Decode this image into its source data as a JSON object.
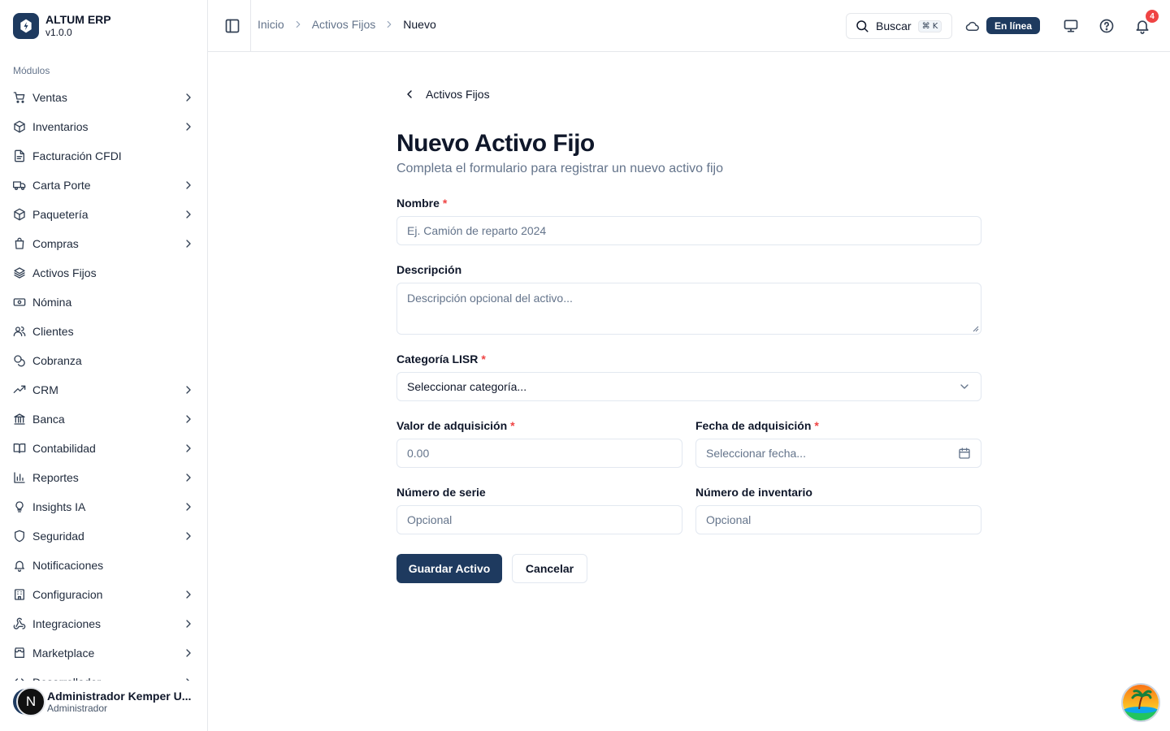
{
  "app": {
    "name": "ALTUM ERP",
    "version": "v1.0.0"
  },
  "sidebar": {
    "section_label": "Módulos",
    "items": [
      {
        "label": "Ventas",
        "icon": "cart-icon",
        "expandable": true
      },
      {
        "label": "Inventarios",
        "icon": "package-icon",
        "expandable": true
      },
      {
        "label": "Facturación CFDI",
        "icon": "file-text-icon",
        "expandable": false
      },
      {
        "label": "Carta Porte",
        "icon": "truck-icon",
        "expandable": true
      },
      {
        "label": "Paquetería",
        "icon": "package-icon",
        "expandable": true
      },
      {
        "label": "Compras",
        "icon": "shopping-bag-icon",
        "expandable": true
      },
      {
        "label": "Activos Fijos",
        "icon": "layers-icon",
        "expandable": false
      },
      {
        "label": "Nómina",
        "icon": "banknote-icon",
        "expandable": false
      },
      {
        "label": "Clientes",
        "icon": "users-icon",
        "expandable": false
      },
      {
        "label": "Cobranza",
        "icon": "coins-icon",
        "expandable": false
      },
      {
        "label": "CRM",
        "icon": "trending-up-icon",
        "expandable": true
      },
      {
        "label": "Banca",
        "icon": "landmark-icon",
        "expandable": true
      },
      {
        "label": "Contabilidad",
        "icon": "book-open-icon",
        "expandable": true
      },
      {
        "label": "Reportes",
        "icon": "bar-chart-icon",
        "expandable": true
      },
      {
        "label": "Insights IA",
        "icon": "lightbulb-icon",
        "expandable": true
      },
      {
        "label": "Seguridad",
        "icon": "shield-icon",
        "expandable": true
      },
      {
        "label": "Notificaciones",
        "icon": "bell-icon",
        "expandable": false
      },
      {
        "label": "Configuracion",
        "icon": "building-icon",
        "expandable": true
      },
      {
        "label": "Integraciones",
        "icon": "webhook-icon",
        "expandable": true
      },
      {
        "label": "Marketplace",
        "icon": "store-icon",
        "expandable": true
      },
      {
        "label": "Desarrollador",
        "icon": "code-icon",
        "expandable": true
      }
    ]
  },
  "user": {
    "initial": "N",
    "name": "Administrador Kemper U...",
    "role": "Administrador"
  },
  "header": {
    "breadcrumbs": [
      "Inicio",
      "Activos Fijos",
      "Nuevo"
    ],
    "search_label": "Buscar",
    "search_shortcut": "⌘ K",
    "status": "En línea",
    "notification_count": "4"
  },
  "form": {
    "back_label": "Activos Fijos",
    "title": "Nuevo Activo Fijo",
    "subtitle": "Completa el formulario para registrar un nuevo activo fijo",
    "required_mark": "*",
    "fields": {
      "nombre": {
        "label": "Nombre",
        "placeholder": "Ej. Camión de reparto 2024",
        "value": ""
      },
      "descripcion": {
        "label": "Descripción",
        "placeholder": "Descripción opcional del activo...",
        "value": ""
      },
      "categoria": {
        "label": "Categoría LISR",
        "selected": "Seleccionar categoría..."
      },
      "valor": {
        "label": "Valor de adquisición",
        "placeholder": "0.00",
        "value": ""
      },
      "fecha": {
        "label": "Fecha de adquisición",
        "placeholder": "Seleccionar fecha..."
      },
      "serie": {
        "label": "Número de serie",
        "placeholder": "Opcional",
        "value": ""
      },
      "inventario": {
        "label": "Número de inventario",
        "placeholder": "Opcional",
        "value": ""
      }
    },
    "save_label": "Guardar Activo",
    "cancel_label": "Cancelar"
  },
  "colors": {
    "primary": "#1e3a5f",
    "danger": "#ef4444",
    "muted_text": "#64748b",
    "border": "#e2e8f0"
  }
}
